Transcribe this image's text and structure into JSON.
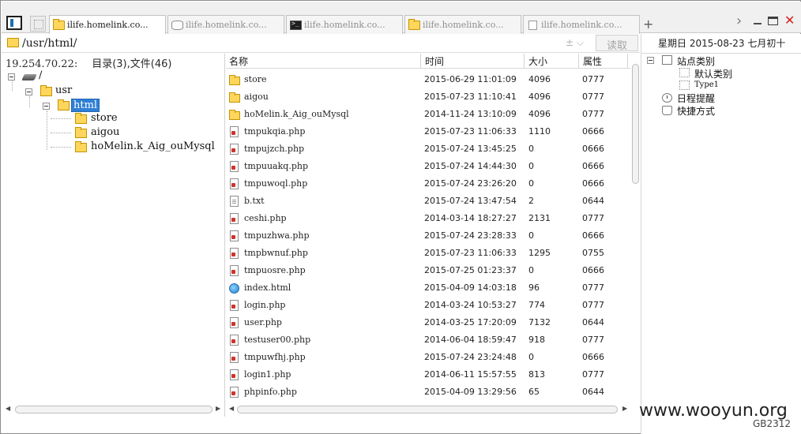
{
  "tabs": [
    {
      "label": "ilife.homelink.co...",
      "icon": "folder-icon",
      "active": true
    },
    {
      "label": "ilife.homelink.co...",
      "icon": "database-icon",
      "active": false
    },
    {
      "label": "ilife.homelink.co...",
      "icon": "terminal-icon",
      "active": false
    },
    {
      "label": "ilife.homelink.co...",
      "icon": "folder-icon",
      "active": false
    },
    {
      "label": "ilife.homelink.co...",
      "icon": "file-icon",
      "active": false
    }
  ],
  "titlebar": {
    "new_tab": "+",
    "more": "›",
    "close": "✕"
  },
  "address": {
    "path": "/usr/html/",
    "history_glyph": "± ⌵",
    "read_label": "读取"
  },
  "info": {
    "ip": "19.254.70.22:",
    "dir_info": "目录(3),文件(46)"
  },
  "tree": {
    "root": "/",
    "usr": "usr",
    "html": "html",
    "children": [
      "store",
      "aigou",
      "hoMelin.k_Aig_ouMysql"
    ]
  },
  "columns": {
    "name": "名称",
    "time": "时间",
    "size": "大小",
    "attr": "属性"
  },
  "files": [
    {
      "name": "store",
      "time": "2015-06-29 11:01:09",
      "size": "4096",
      "attr": "0777",
      "type": "folder"
    },
    {
      "name": "aigou",
      "time": "2015-07-23 11:10:41",
      "size": "4096",
      "attr": "0777",
      "type": "folder"
    },
    {
      "name": "hoMelin.k_Aig_ouMysql",
      "time": "2014-11-24 13:10:09",
      "size": "4096",
      "attr": "0777",
      "type": "folder"
    },
    {
      "name": "tmpukqia.php",
      "time": "2015-07-23 11:06:33",
      "size": "1110",
      "attr": "0666",
      "type": "php"
    },
    {
      "name": "tmpujzch.php",
      "time": "2015-07-24 13:45:25",
      "size": "0",
      "attr": "0666",
      "type": "php"
    },
    {
      "name": "tmpuuakq.php",
      "time": "2015-07-24 14:44:30",
      "size": "0",
      "attr": "0666",
      "type": "php"
    },
    {
      "name": "tmpuwoql.php",
      "time": "2015-07-24 23:26:20",
      "size": "0",
      "attr": "0666",
      "type": "php"
    },
    {
      "name": "b.txt",
      "time": "2015-07-24 13:47:54",
      "size": "2",
      "attr": "0644",
      "type": "txt"
    },
    {
      "name": "ceshi.php",
      "time": "2014-03-14 18:27:27",
      "size": "2131",
      "attr": "0777",
      "type": "php"
    },
    {
      "name": "tmpuzhwa.php",
      "time": "2015-07-24 23:28:33",
      "size": "0",
      "attr": "0666",
      "type": "php"
    },
    {
      "name": "tmpbwnuf.php",
      "time": "2015-07-23 11:06:33",
      "size": "1295",
      "attr": "0755",
      "type": "php"
    },
    {
      "name": "tmpuosre.php",
      "time": "2015-07-25 01:23:37",
      "size": "0",
      "attr": "0666",
      "type": "php"
    },
    {
      "name": "index.html",
      "time": "2015-04-09 14:03:18",
      "size": "96",
      "attr": "0777",
      "type": "html"
    },
    {
      "name": "login.php",
      "time": "2014-03-24 10:53:27",
      "size": "774",
      "attr": "0777",
      "type": "php"
    },
    {
      "name": "user.php",
      "time": "2014-03-25 17:20:09",
      "size": "7132",
      "attr": "0644",
      "type": "php"
    },
    {
      "name": "testuser00.php",
      "time": "2014-06-04 18:59:47",
      "size": "918",
      "attr": "0777",
      "type": "php"
    },
    {
      "name": "tmpuwfhj.php",
      "time": "2015-07-24 23:24:48",
      "size": "0",
      "attr": "0666",
      "type": "php"
    },
    {
      "name": "login1.php",
      "time": "2014-06-11 15:57:55",
      "size": "813",
      "attr": "0777",
      "type": "php"
    },
    {
      "name": "phpinfo.php",
      "time": "2015-04-09 13:29:56",
      "size": "65",
      "attr": "0644",
      "type": "php"
    }
  ],
  "right_panel": {
    "date": "星期日  2015-08-23  七月初十",
    "site_category": "站点类别",
    "default_category": "默认类别",
    "type1": "Type1",
    "reminder": "日程提醒",
    "shortcut": "快捷方式"
  },
  "watermark": "www.wooyun.org",
  "encoding": "GB2312",
  "colors": {
    "selection": "#2f7fd6",
    "folder": "#ffd65c",
    "close": "#d41f1f"
  }
}
